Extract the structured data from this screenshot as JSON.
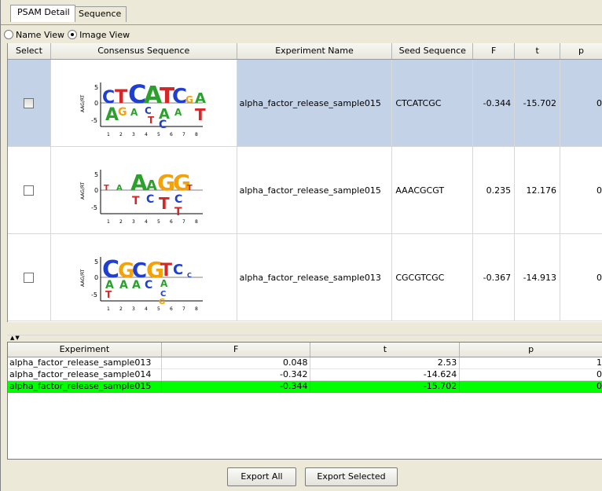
{
  "tabs": [
    {
      "label": "PSAM Detail",
      "active": true
    },
    {
      "label": "Sequence",
      "active": false
    }
  ],
  "view": {
    "name_view_label": "Name View",
    "image_view_label": "Image View",
    "selected": "Image View"
  },
  "top_table": {
    "columns": [
      "Select",
      "Consensus Sequence",
      "Experiment Name",
      "Seed Sequence",
      "F",
      "t",
      "p"
    ],
    "rows": [
      {
        "experiment": "alpha_factor_release_sample015",
        "seed": "CTCATCGC",
        "F": "-0.344",
        "t": "-15.702",
        "p": "0",
        "selected": true,
        "logo": {
          "ylabel": "AAG/RT",
          "ticks": [
            "5",
            "0",
            "-5"
          ]
        }
      },
      {
        "experiment": "alpha_factor_release_sample015",
        "seed": "AAACGCGT",
        "F": "0.235",
        "t": "12.176",
        "p": "0",
        "selected": false,
        "logo": {
          "ylabel": "AAG/RT",
          "ticks": [
            "5",
            "0",
            "-5"
          ]
        }
      },
      {
        "experiment": "alpha_factor_release_sample013",
        "seed": "CGCGTCGC",
        "F": "-0.367",
        "t": "-14.913",
        "p": "0",
        "selected": false,
        "logo": {
          "ylabel": "AAG/RT",
          "ticks": [
            "5",
            "0",
            "-5"
          ]
        }
      }
    ]
  },
  "bottom_table": {
    "columns": [
      "Experiment",
      "F",
      "t",
      "p"
    ],
    "rows": [
      {
        "experiment": "alpha_factor_release_sample013",
        "F": "0.048",
        "t": "2.53",
        "p": "1",
        "highlight": false
      },
      {
        "experiment": "alpha_factor_release_sample014",
        "F": "-0.342",
        "t": "-14.624",
        "p": "0",
        "highlight": false
      },
      {
        "experiment": "alpha_factor_release_sample015",
        "F": "-0.344",
        "t": "-15.702",
        "p": "0",
        "highlight": true
      }
    ]
  },
  "buttons": {
    "export_all": "Export All",
    "export_selected": "Export Selected"
  },
  "colors": {
    "selected_row": "#c4d2e8",
    "highlight_row": "#00ff00",
    "base_A": "#2ca02c",
    "base_C": "#1f3fd0",
    "base_G": "#f2a20a",
    "base_T": "#d62728"
  }
}
